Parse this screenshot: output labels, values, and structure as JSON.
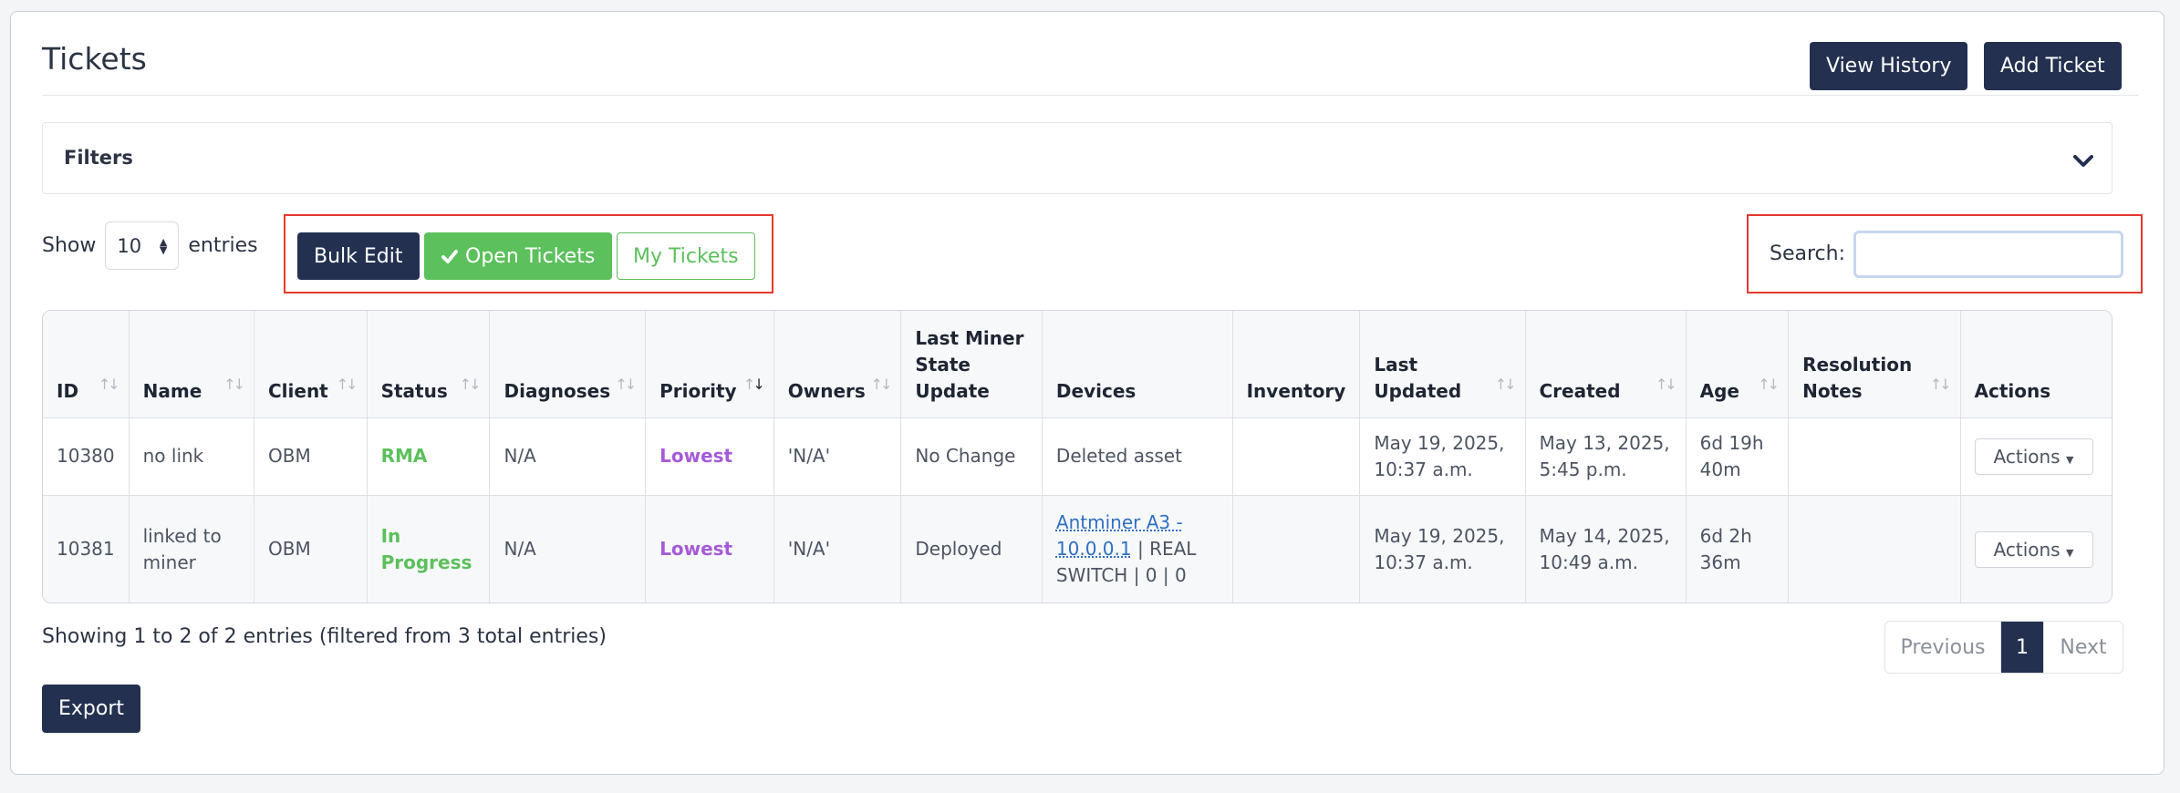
{
  "header": {
    "title": "Tickets",
    "view_history": "View History",
    "add_ticket": "Add Ticket"
  },
  "filters": {
    "label": "Filters",
    "icon": "chevron-down-icon"
  },
  "length": {
    "show": "Show",
    "value": "10",
    "entries": "entries"
  },
  "toolbar": {
    "bulk_edit": "Bulk Edit",
    "open_tickets": "Open Tickets",
    "my_tickets": "My Tickets"
  },
  "search": {
    "label": "Search:",
    "value": "",
    "placeholder": ""
  },
  "table": {
    "columns": [
      "ID",
      "Name",
      "Client",
      "Status",
      "Diagnoses",
      "Priority",
      "Owners",
      "Last Miner State Update",
      "Devices",
      "Inventory",
      "Last Updated",
      "Created",
      "Age",
      "Resolution Notes",
      "Actions"
    ],
    "rows": [
      {
        "id": "10380",
        "name": "no link",
        "client": "OBM",
        "status": "RMA",
        "diagnoses": "N/A",
        "priority": "Lowest",
        "owners": "'N/A'",
        "last_miner_state": "No Change",
        "device_link": "",
        "device_text": "Deleted asset",
        "inventory": "",
        "last_updated": "May 19, 2025, 10:37 a.m.",
        "created": "May 13, 2025, 5:45 p.m.",
        "age": "6d 19h 40m",
        "resolution_notes": "",
        "actions": "Actions"
      },
      {
        "id": "10381",
        "name": "linked to miner",
        "client": "OBM",
        "status": "In Progress",
        "diagnoses": "N/A",
        "priority": "Lowest",
        "owners": "'N/A'",
        "last_miner_state": "Deployed",
        "device_link": "Antminer A3 - 10.0.0.1",
        "device_text": " | REAL SWITCH | 0 | 0",
        "inventory": "",
        "last_updated": "May 19, 2025, 10:37 a.m.",
        "created": "May 14, 2025, 10:49 a.m.",
        "age": "6d 2h 36m",
        "resolution_notes": "",
        "actions": "Actions"
      }
    ]
  },
  "footer": {
    "summary": "Showing 1 to 2 of 2 entries (filtered from 3 total entries)",
    "export": "Export"
  },
  "pagination": {
    "previous": "Previous",
    "current": "1",
    "next": "Next"
  },
  "colors": {
    "primary_dark": "#233050",
    "success_green": "#5cc05c",
    "priority_purple": "#a55bd8",
    "highlight_red": "#e4382f"
  }
}
